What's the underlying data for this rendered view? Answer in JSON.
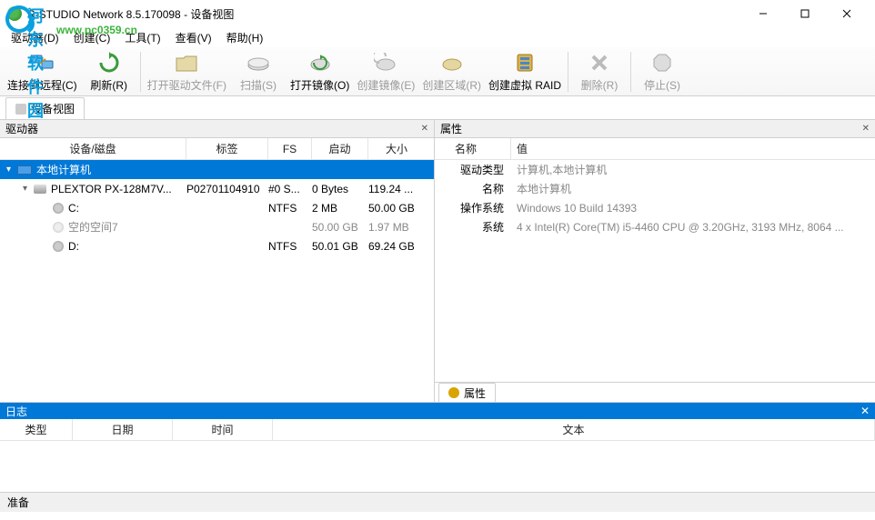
{
  "watermark": {
    "line1": "河东软件园",
    "line2": "www.pc0359.cn"
  },
  "title": "R-STUDIO Network 8.5.170098 - 设备视图",
  "menu": {
    "drive": "驱动器(D)",
    "create": "创建(C)",
    "tools": "工具(T)",
    "view": "查看(V)",
    "help": "帮助(H)"
  },
  "toolbar": {
    "connect": "连接到远程(C)",
    "refresh": "刷新(R)",
    "opendrv": "打开驱动文件(F)",
    "scan": "扫描(S)",
    "openimg": "打开镜像(O)",
    "createimg": "创建镜像(E)",
    "region": "创建区域(R)",
    "raid": "创建虚拟 RAID",
    "remove": "删除(R)",
    "stop": "停止(S)"
  },
  "tab": {
    "device_view": "设备视图"
  },
  "left": {
    "title": "驱动器",
    "cols": {
      "device": "设备/磁盘",
      "label": "标签",
      "fs": "FS",
      "start": "启动",
      "size": "大小"
    },
    "root": "本地计算机",
    "rows": [
      {
        "name": "PLEXTOR PX-128M7V...",
        "label": "P02701104910",
        "fs": "#0 S...",
        "start": "0 Bytes",
        "size": "119.24 ..."
      },
      {
        "name": "C:",
        "label": "",
        "fs": "NTFS",
        "start": "2 MB",
        "size": "50.00 GB"
      },
      {
        "name": "空的空间7",
        "label": "",
        "fs": "",
        "start": "50.00 GB",
        "size": "1.97 MB"
      },
      {
        "name": "D:",
        "label": "",
        "fs": "NTFS",
        "start": "50.01 GB",
        "size": "69.24 GB"
      }
    ]
  },
  "right": {
    "title": "属性",
    "cols": {
      "name": "名称",
      "value": "值"
    },
    "rows": [
      {
        "k": "驱动类型",
        "v": "计算机,本地计算机"
      },
      {
        "k": "名称",
        "v": "本地计算机"
      },
      {
        "k": "操作系统",
        "v": "Windows 10 Build 14393"
      },
      {
        "k": "系统",
        "v": "4 x Intel(R) Core(TM) i5-4460  CPU @ 3.20GHz, 3193 MHz, 8064 ..."
      }
    ],
    "tab": "属性"
  },
  "log": {
    "title": "日志",
    "cols": {
      "type": "类型",
      "date": "日期",
      "time": "时间",
      "text": "文本"
    }
  },
  "status": "准备"
}
